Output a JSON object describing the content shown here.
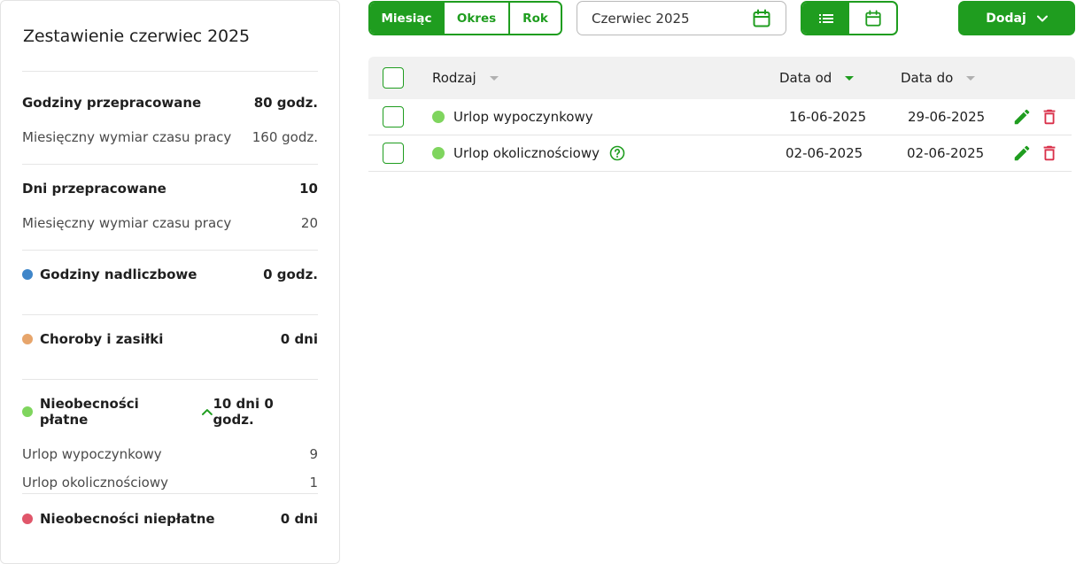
{
  "summary": {
    "title": "Zestawienie czerwiec 2025",
    "hours_worked": {
      "label": "Godziny przepracowane",
      "value": "80 godz."
    },
    "hours_norm": {
      "label": "Miesięczny wymiar czasu pracy",
      "value": "160 godz."
    },
    "days_worked": {
      "label": "Dni przepracowane",
      "value": "10"
    },
    "days_norm": {
      "label": "Miesięczny wymiar czasu pracy",
      "value": "20"
    },
    "overtime": {
      "label": "Godziny nadliczbowe",
      "value": "0 godz.",
      "color": "#3f86c9"
    },
    "sickness": {
      "label": "Choroby i zasiłki",
      "value": "0 dni",
      "color": "#e7a56b"
    },
    "paid_absence": {
      "label": "Nieobecności płatne",
      "value": "10 dni 0 godz.",
      "color": "#7fd55e",
      "items": [
        {
          "label": "Urlop wypoczynkowy",
          "value": "9"
        },
        {
          "label": "Urlop okolicznościowy",
          "value": "1"
        }
      ]
    },
    "unpaid_absence": {
      "label": "Nieobecności niepłatne",
      "value": "0 dni",
      "color": "#e0566a"
    }
  },
  "toolbar": {
    "period_options": [
      "Miesiąc",
      "Okres",
      "Rok"
    ],
    "selected_period": "Miesiąc",
    "date_value": "Czerwiec 2025",
    "add_label": "Dodaj"
  },
  "table": {
    "columns": {
      "type": "Rodzaj",
      "date_from": "Data od",
      "date_to": "Data do"
    },
    "sorted_by": "Data od",
    "rows": [
      {
        "type": "Urlop wypoczynkowy",
        "date_from": "16-06-2025",
        "date_to": "29-06-2025",
        "help": false
      },
      {
        "type": "Urlop okolicznościowy",
        "date_from": "02-06-2025",
        "date_to": "02-06-2025",
        "help": true
      }
    ]
  },
  "colors": {
    "accent": "#1f9d1f",
    "delete": "#d9304a",
    "entry_dot": "#7fd55e"
  },
  "icons": [
    "calendar-icon",
    "list-icon",
    "chevron-down-icon",
    "chevron-up-icon",
    "pencil-icon",
    "trash-icon",
    "help-circle-icon"
  ]
}
